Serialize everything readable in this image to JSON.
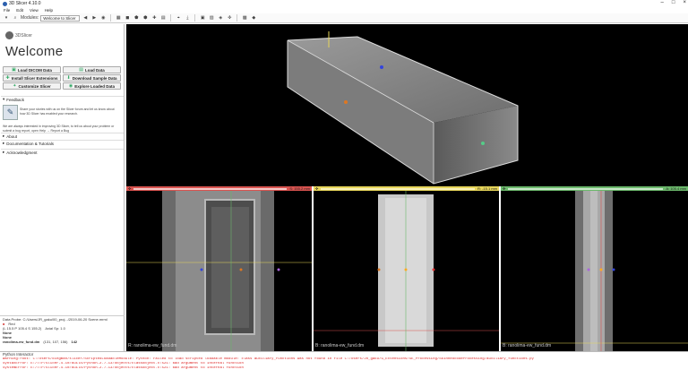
{
  "window": {
    "title": "3D Slicer 4.10.0"
  },
  "menu": [
    "File",
    "Edit",
    "View",
    "Help"
  ],
  "toolbar": {
    "modules_label": "Modules:",
    "module_selected": "Welcome to Slicer"
  },
  "left": {
    "logo_text": "3DSlicer",
    "welcome": "Welcome",
    "buttons": {
      "load_dicom": "Load DICOM Data",
      "load_data": "Load Data",
      "install_ext": "Install Slicer Extensions",
      "download_sample": "Download Sample Data",
      "customize": "Customize Slicer",
      "explore": "Explore Loaded Data"
    },
    "sections": {
      "feedback": "Feedback",
      "about": "About",
      "docs": "Documentation & Tutorials",
      "ack": "Acknowledgment"
    },
    "feedback_text": "Share your stories with us on the Slicer forum and let us know about how 3D Slicer has enabled your research.",
    "feedback_text2": "We are always interested in improving 3D Slicer, to tell us about your problem or submit a bug report, open Help → Report a Bug"
  },
  "probe": {
    "header": "Data Probe: C:/Users/JR_gaku/00_proj.../2019-06-20 Scene.mrml",
    "slice_label": "Red",
    "coords": "(L 15.5 P 105.4 S 155.2)",
    "axial": "Axial Sp: 1.0",
    "layers": [
      "None",
      "None"
    ],
    "volume": "ranolima-ew_fund.dm",
    "voxel": "(131, 107, 156)",
    "value": "142"
  },
  "slices": {
    "red": {
      "bar_text": "S: 155.2 mm",
      "label": "R: ranolima-ew_fund.dm"
    },
    "yellow": {
      "bar_text": "R: -15.1 mm",
      "label": "B: ranolima-ew_fund.dm"
    },
    "green": {
      "bar_text": "A: 105.4 mm",
      "label": "B: ranolima-ew_fund.dm"
    }
  },
  "python": {
    "header": "Python Interactor",
    "lines": [
      "Warning:root: C:/Users/kingman/slicer/ScriptedLoadableModule: Python: Failed to load scripted loadable module: class auxiliary_functions was not found in file C:/Users/JR_gaku/G_Extensions/SE_Processing/SkinnedcodeProcessing/auxiliary_functions.py",
      "SyntaxError: E:/TTP/Slicer-4.10/build/Python-2.7.13/Objects/classobject.c:521: bad argument to internal function",
      "SystemError: E:/TTP/Slicer-4.10/build/Python-2.7.13/Objects/classobject.c:521: bad argument to internal function"
    ]
  },
  "colors": {
    "red": "#d9534f",
    "yellow": "#e6d55a",
    "green": "#6bb86b"
  }
}
